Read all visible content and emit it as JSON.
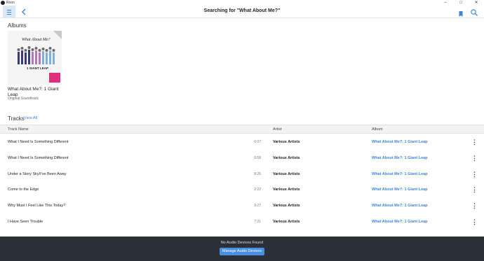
{
  "window": {
    "app_title": "Roon",
    "minimize_icon": "minimize-icon",
    "maximize_icon": "maximize-icon",
    "close_icon": "close-icon"
  },
  "header": {
    "title": "Searching for \"What About Me?\"",
    "menu_icon": "hamburger-menu-icon",
    "back_icon": "back-arrow-icon",
    "bookmark_icon": "bookmark-icon",
    "search_icon": "search-icon",
    "accent_color": "#3b86d6"
  },
  "albums": {
    "section_title": "Albums",
    "items": [
      {
        "name": "What About Me?: 1 Giant Leap",
        "subtitle": "Original Soundtrack",
        "cover_text": "What About Me?",
        "cover_brand": "1 GIANT LEAP"
      }
    ]
  },
  "tracks": {
    "section_title": "Tracks",
    "view_all_label": "View All",
    "columns": {
      "track_name": "Track Name",
      "artist": "Artist",
      "album": "Album"
    },
    "rows": [
      {
        "name": "What I Need Is Something Different",
        "duration": "6:07",
        "artist": "Various Artists",
        "album": "What About Me?: 1 Giant Leap"
      },
      {
        "name": "What I Need Is Something Different",
        "duration": "0:58",
        "artist": "Various Artists",
        "album": "What About Me?: 1 Giant Leap"
      },
      {
        "name": "Under a Story Sky/I've Been Away",
        "duration": "8:25",
        "artist": "Various Artists",
        "album": "What About Me?: 1 Giant Leap"
      },
      {
        "name": "Come to the Edge",
        "duration": "2:22",
        "artist": "Various Artists",
        "album": "What About Me?: 1 Giant Leap"
      },
      {
        "name": "Why Must I Feel Like This Today?",
        "duration": "9:27",
        "artist": "Various Artists",
        "album": "What About Me?: 1 Giant Leap"
      },
      {
        "name": "I Have Seen Trouble",
        "duration": "7:21",
        "artist": "Various Artists",
        "album": "What About Me?: 1 Giant Leap"
      }
    ]
  },
  "footer": {
    "message": "No Audio Devices Found",
    "button_label": "Manage Audio Devices"
  }
}
